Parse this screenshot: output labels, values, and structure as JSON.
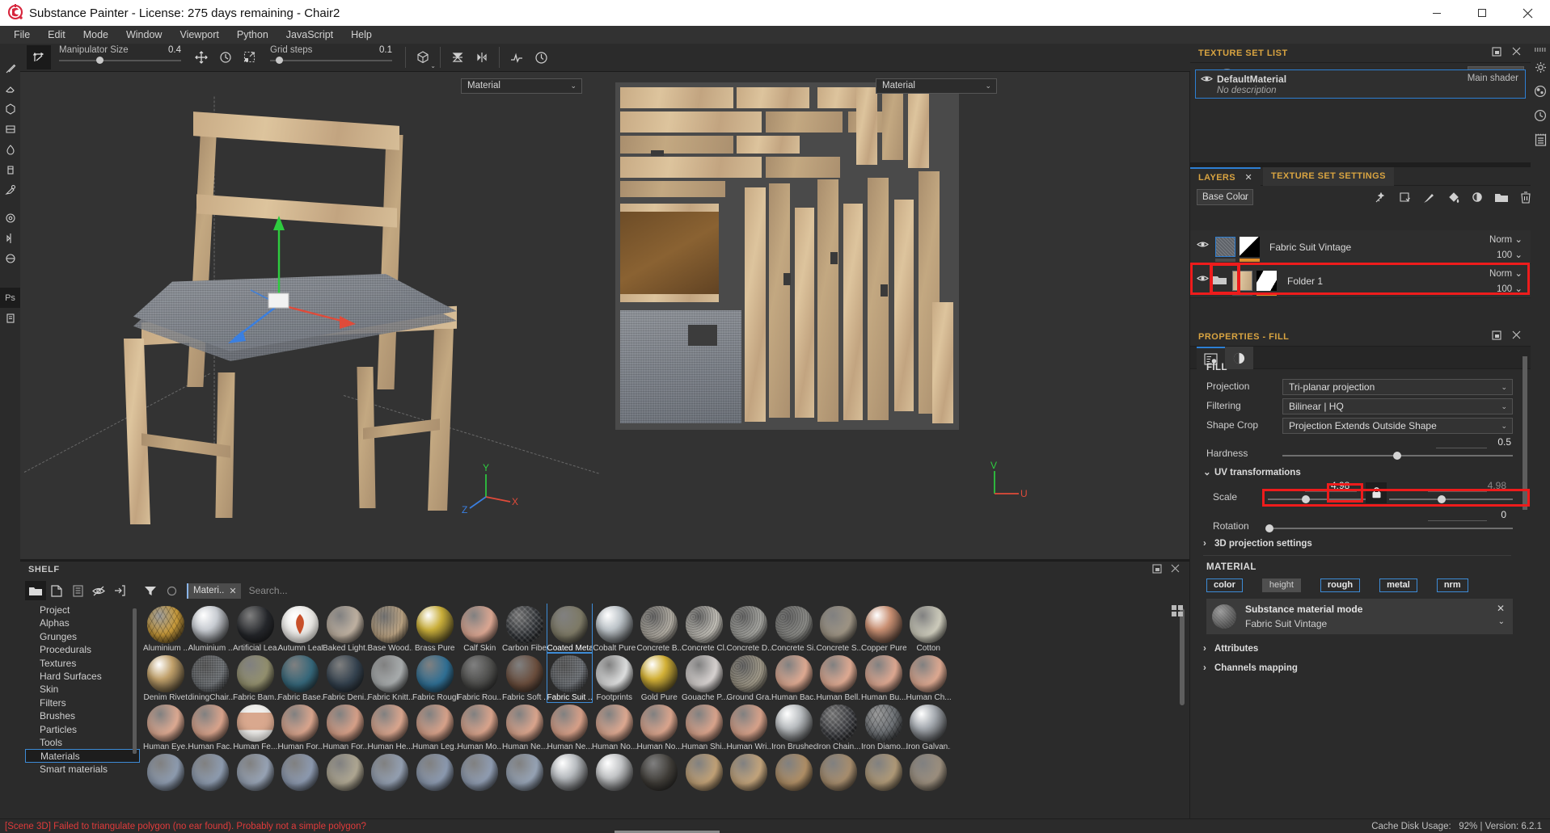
{
  "window": {
    "title": "Substance Painter - License: 275 days remaining - Chair2",
    "minimize": "—",
    "maximize": "▢",
    "close": "✕"
  },
  "menubar": {
    "items": [
      "File",
      "Edit",
      "Mode",
      "Window",
      "Viewport",
      "Python",
      "JavaScript",
      "Help"
    ]
  },
  "toolbar": {
    "manipulator_label": "Manipulator Size",
    "manipulator_value": "0.4",
    "grid_label": "Grid steps",
    "grid_value": "0.1",
    "icons": [
      "transform-snap-icon",
      "move-tool-icon",
      "rotate-tool-icon",
      "scale-tool-icon",
      "cube-icon",
      "symmetry-plane-icon",
      "mirror-icon",
      "performance-icon",
      "reset-view-icon"
    ],
    "right_icons": [
      "pause-icon",
      "display-channel-icon",
      "material-view-icon",
      "camera-view-icon",
      "screenshot-icon"
    ]
  },
  "viewport": {
    "left_combo": "Material",
    "right_combo": "Material",
    "axis_left": [
      "Y",
      "Z",
      "X"
    ],
    "axis_right": [
      "V",
      "U"
    ]
  },
  "texture_set_list": {
    "title": "TEXTURE SET LIST",
    "settings_label": "Settings",
    "item_name": "DefaultMaterial",
    "item_description": "No description",
    "item_shader": "Main shader"
  },
  "layers_panel": {
    "tab_layers": "LAYERS",
    "tab_texture_set_settings": "TEXTURE SET SETTINGS",
    "channel_selector": "Base Color",
    "tool_icons": [
      "smart-material-icon",
      "smart-mask-icon",
      "paint-layer-icon",
      "fill-layer-icon",
      "effect-layer-icon",
      "folder-icon",
      "delete-icon"
    ],
    "layers": [
      {
        "name": "Fabric Suit Vintage",
        "blend": "Norm",
        "opacity": "100",
        "selected": true,
        "type": "fill"
      },
      {
        "name": "Folder 1",
        "blend": "Norm",
        "opacity": "100",
        "selected": false,
        "type": "folder"
      }
    ]
  },
  "properties": {
    "title": "PROPERTIES - FILL",
    "section_fill": "FILL",
    "rows": [
      {
        "label": "Projection",
        "value": "Tri-planar projection",
        "highlight": true
      },
      {
        "label": "Filtering",
        "value": "Bilinear | HQ",
        "highlight": false
      },
      {
        "label": "Shape Crop",
        "value": "Projection Extends Outside Shape",
        "highlight": false
      }
    ],
    "hardness_label": "Hardness",
    "hardness_value": "0.5",
    "uv_transformations": "UV transformations",
    "scale_label": "Scale",
    "scale_value": "4.98",
    "scale_value_right": "4.98",
    "rotation_label": "Rotation",
    "rotation_value": "0",
    "projection_3d": "3D projection settings",
    "section_material": "MATERIAL",
    "channels": [
      {
        "label": "color",
        "on": true
      },
      {
        "label": "height",
        "on": false
      },
      {
        "label": "rough",
        "on": true
      },
      {
        "label": "metal",
        "on": true
      },
      {
        "label": "nrm",
        "on": true
      }
    ],
    "material_mode_title": "Substance material mode",
    "material_mode_value": "Fabric Suit Vintage",
    "attributes": "Attributes",
    "channels_mapping": "Channels mapping"
  },
  "shelf": {
    "title": "SHELF",
    "tool_icons": [
      "folder-icon",
      "new-doc-icon",
      "save-icon",
      "hide-icon",
      "import-icon",
      "filter-icon",
      "circle-icon"
    ],
    "filter_chip": "Materi..",
    "search_placeholder": "Search...",
    "categories": [
      "Project",
      "Alphas",
      "Grunges",
      "Procedurals",
      "Textures",
      "Hard Surfaces",
      "Skin",
      "Filters",
      "Brushes",
      "Particles",
      "Tools",
      "Materials",
      "Smart materials"
    ],
    "selected_category": "Materials",
    "rows": [
      {
        "items": [
          {
            "name": "Aluminium ...",
            "color": "#c89a3a",
            "pattern": "hex"
          },
          {
            "name": "Aluminium ...",
            "color": "#c8ccd2",
            "pattern": "metal"
          },
          {
            "name": "Artificial Lea...",
            "color": "#24262a",
            "pattern": "flat"
          },
          {
            "name": "Autumn Leaf",
            "color": "#e8e6e2",
            "pattern": "leaf"
          },
          {
            "name": "Baked Light...",
            "color": "#c0b2a2",
            "pattern": "flat"
          },
          {
            "name": "Base Wood...",
            "color": "#bda584",
            "pattern": "wood"
          },
          {
            "name": "Brass Pure",
            "color": "#c9ae3a",
            "pattern": "metal"
          },
          {
            "name": "Calf Skin",
            "color": "#dda893",
            "pattern": "flat"
          },
          {
            "name": "Carbon Fiber",
            "color": "#2c2f33",
            "pattern": "carbon"
          },
          {
            "name": "Coated Metal",
            "color": "#7e7a66",
            "pattern": "flat",
            "selected": true
          },
          {
            "name": "Cobalt Pure",
            "color": "#bcc3c8",
            "pattern": "metal"
          },
          {
            "name": "Concrete B...",
            "color": "#b7b2a8",
            "pattern": "noise"
          },
          {
            "name": "Concrete Cl...",
            "color": "#c7c4bc",
            "pattern": "noise"
          },
          {
            "name": "Concrete D...",
            "color": "#a9a9a4",
            "pattern": "noise"
          },
          {
            "name": "Concrete Si...",
            "color": "#8e8e8a",
            "pattern": "noise"
          },
          {
            "name": "Concrete S...",
            "color": "#9e9484",
            "pattern": "flat"
          },
          {
            "name": "Copper Pure",
            "color": "#c98f72",
            "pattern": "metal"
          },
          {
            "name": "Cotton",
            "color": "#cfcdbd",
            "pattern": "flat"
          }
        ]
      },
      {
        "items": [
          {
            "name": "Denim Rivet",
            "color": "#c0a06a",
            "pattern": "metal"
          },
          {
            "name": "diningChair...",
            "color": "#6e7276",
            "pattern": "fabric"
          },
          {
            "name": "Fabric Bam...",
            "color": "#93906e",
            "pattern": "flat"
          },
          {
            "name": "Fabric Base...",
            "color": "#35677a",
            "pattern": "flat"
          },
          {
            "name": "Fabric Deni...",
            "color": "#33414e",
            "pattern": "flat"
          },
          {
            "name": "Fabric Knitt...",
            "color": "#a9adae",
            "pattern": "flat"
          },
          {
            "name": "Fabric Rough",
            "color": "#2f6f94",
            "pattern": "flat"
          },
          {
            "name": "Fabric Rou...",
            "color": "#4c4c4a",
            "pattern": "flat"
          },
          {
            "name": "Fabric Soft ...",
            "color": "#6a4d3c",
            "pattern": "flat"
          },
          {
            "name": "Fabric Suit ...",
            "color": "#6d7176",
            "pattern": "fabric",
            "selected": true
          },
          {
            "name": "Footprints",
            "color": "#dfe0e0",
            "pattern": "flat"
          },
          {
            "name": "Gold Pure",
            "color": "#d2b036",
            "pattern": "metal"
          },
          {
            "name": "Gouache P...",
            "color": "#d9d4d2",
            "pattern": "flat"
          },
          {
            "name": "Ground Gra...",
            "color": "#a49d8c",
            "pattern": "noise"
          },
          {
            "name": "Human Bac...",
            "color": "#e0ab93",
            "pattern": "flat"
          },
          {
            "name": "Human Bell...",
            "color": "#e0ab93",
            "pattern": "flat"
          },
          {
            "name": "Human Bu...",
            "color": "#dfa992",
            "pattern": "flat"
          },
          {
            "name": "Human Ch...",
            "color": "#dfaa92",
            "pattern": "flat"
          }
        ]
      },
      {
        "items": [
          {
            "name": "Human Eye...",
            "color": "#dfab93",
            "pattern": "flat"
          },
          {
            "name": "Human Fac...",
            "color": "#dba58d",
            "pattern": "flat"
          },
          {
            "name": "Human Fe...",
            "color": "#e8e6e2",
            "pattern": "face"
          },
          {
            "name": "Human For...",
            "color": "#dba68e",
            "pattern": "flat"
          },
          {
            "name": "Human For...",
            "color": "#d8a189",
            "pattern": "flat"
          },
          {
            "name": "Human He...",
            "color": "#dca78f",
            "pattern": "flat"
          },
          {
            "name": "Human Leg...",
            "color": "#d9a38b",
            "pattern": "flat"
          },
          {
            "name": "Human Mo...",
            "color": "#dba58d",
            "pattern": "flat"
          },
          {
            "name": "Human Ne...",
            "color": "#dca68e",
            "pattern": "flat"
          },
          {
            "name": "Human Ne...",
            "color": "#d9a189",
            "pattern": "flat"
          },
          {
            "name": "Human No...",
            "color": "#dfaa92",
            "pattern": "flat"
          },
          {
            "name": "Human No...",
            "color": "#dca68e",
            "pattern": "flat"
          },
          {
            "name": "Human Shi...",
            "color": "#dba58d",
            "pattern": "flat"
          },
          {
            "name": "Human Wri...",
            "color": "#d9a38b",
            "pattern": "flat"
          },
          {
            "name": "Iron Brushed",
            "color": "#b9bdc0",
            "pattern": "metal"
          },
          {
            "name": "Iron Chain...",
            "color": "#35363a",
            "pattern": "carbon"
          },
          {
            "name": "Iron Diamo...",
            "color": "#6e7276",
            "pattern": "hex"
          },
          {
            "name": "Iron Galvan...",
            "color": "#a5aab0",
            "pattern": "metal"
          }
        ]
      },
      {
        "items": [
          {
            "name": "",
            "color": "#8e9cb0",
            "pattern": "flat"
          },
          {
            "name": "",
            "color": "#8e9cb0",
            "pattern": "flat"
          },
          {
            "name": "",
            "color": "#98a4b6",
            "pattern": "flat"
          },
          {
            "name": "",
            "color": "#8d9ab0",
            "pattern": "flat"
          },
          {
            "name": "",
            "color": "#b0a893",
            "pattern": "flat"
          },
          {
            "name": "",
            "color": "#94a0b2",
            "pattern": "flat"
          },
          {
            "name": "",
            "color": "#8c9ab0",
            "pattern": "flat"
          },
          {
            "name": "",
            "color": "#909db2",
            "pattern": "flat"
          },
          {
            "name": "",
            "color": "#97a4b6",
            "pattern": "flat"
          },
          {
            "name": "",
            "color": "#b8bcc0",
            "pattern": "metal"
          },
          {
            "name": "",
            "color": "#c2c4c6",
            "pattern": "metal"
          },
          {
            "name": "",
            "color": "#3e3b36",
            "pattern": "flat"
          },
          {
            "name": "",
            "color": "#c2a277",
            "pattern": "flat"
          },
          {
            "name": "",
            "color": "#c4a57c",
            "pattern": "flat"
          },
          {
            "name": "",
            "color": "#b08f66",
            "pattern": "flat"
          },
          {
            "name": "",
            "color": "#a88e6e",
            "pattern": "flat"
          },
          {
            "name": "",
            "color": "#b09a78",
            "pattern": "flat"
          },
          {
            "name": "",
            "color": "#9c8f7e",
            "pattern": "flat"
          }
        ]
      }
    ]
  },
  "status": {
    "error": "[Scene 3D] Failed to triangulate polygon (no ear found). Probably not a simple polygon?",
    "cache_label": "Cache Disk Usage:",
    "cache_value": "92% | Version: 6.2.1"
  },
  "colors": {
    "accent_orange": "#d9a441",
    "accent_blue": "#2d7fd3",
    "highlight_red": "#ee1c1c",
    "error_red": "#e03b3b"
  }
}
